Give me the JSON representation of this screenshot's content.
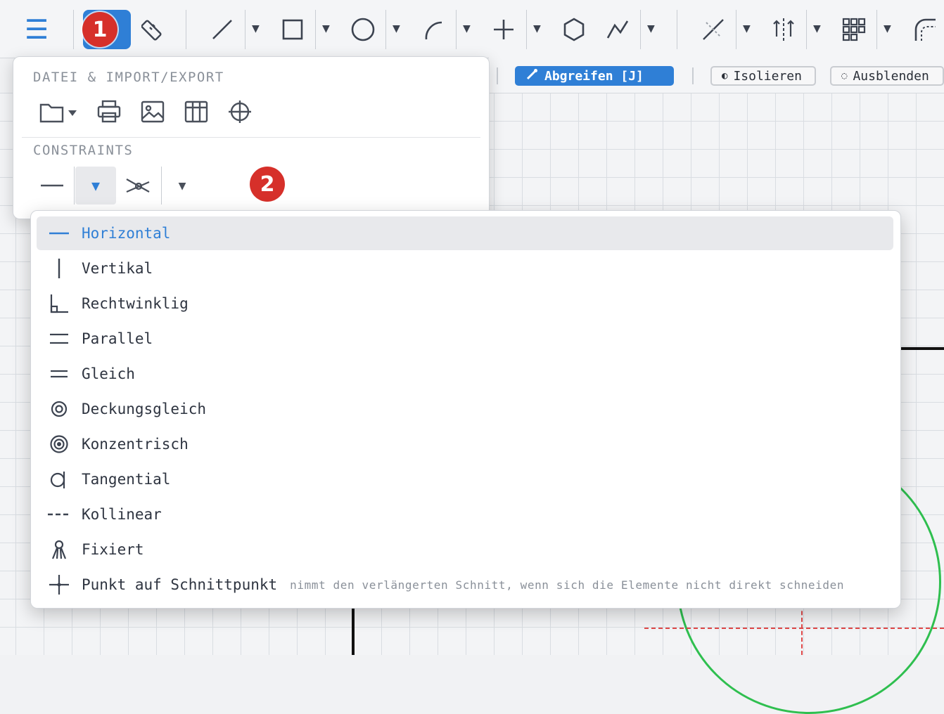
{
  "toolbar": {
    "badge1": "1",
    "tools": [
      "menu-icon",
      "measure-icon",
      "line-icon",
      "rectangle-icon",
      "circle-icon",
      "arc-icon",
      "point-icon",
      "polygon-icon",
      "polyline-icon",
      "trim-icon",
      "mirror-icon",
      "pattern-icon",
      "fillet-icon"
    ]
  },
  "subbar": {
    "snap_label": "Abgreifen [J]",
    "isolate_label": "Isolieren",
    "hide_label": "Ausblenden"
  },
  "panel": {
    "file_section_title": "DATEI & IMPORT/EXPORT",
    "constraints_section_title": "CONSTRAINTS",
    "badge2": "2"
  },
  "menu": {
    "items": [
      {
        "label": "Horizontal",
        "icon": "horizontal-icon",
        "selected": true
      },
      {
        "label": "Vertikal",
        "icon": "vertical-icon"
      },
      {
        "label": "Rechtwinklig",
        "icon": "perpendicular-icon"
      },
      {
        "label": "Parallel",
        "icon": "parallel-icon"
      },
      {
        "label": "Gleich",
        "icon": "equal-icon"
      },
      {
        "label": "Deckungsgleich",
        "icon": "coincident-icon"
      },
      {
        "label": "Konzentrisch",
        "icon": "concentric-icon"
      },
      {
        "label": "Tangential",
        "icon": "tangent-icon"
      },
      {
        "label": "Kollinear",
        "icon": "collinear-icon"
      },
      {
        "label": "Fixiert",
        "icon": "fixed-icon"
      },
      {
        "label": "Punkt auf Schnittpunkt",
        "icon": "intersection-point-icon",
        "hint": "nimmt den verlängerten Schnitt, wenn sich die Elemente nicht direkt schneiden"
      }
    ]
  },
  "colors": {
    "accent": "#2f7fd6",
    "badge": "#d6302a"
  }
}
